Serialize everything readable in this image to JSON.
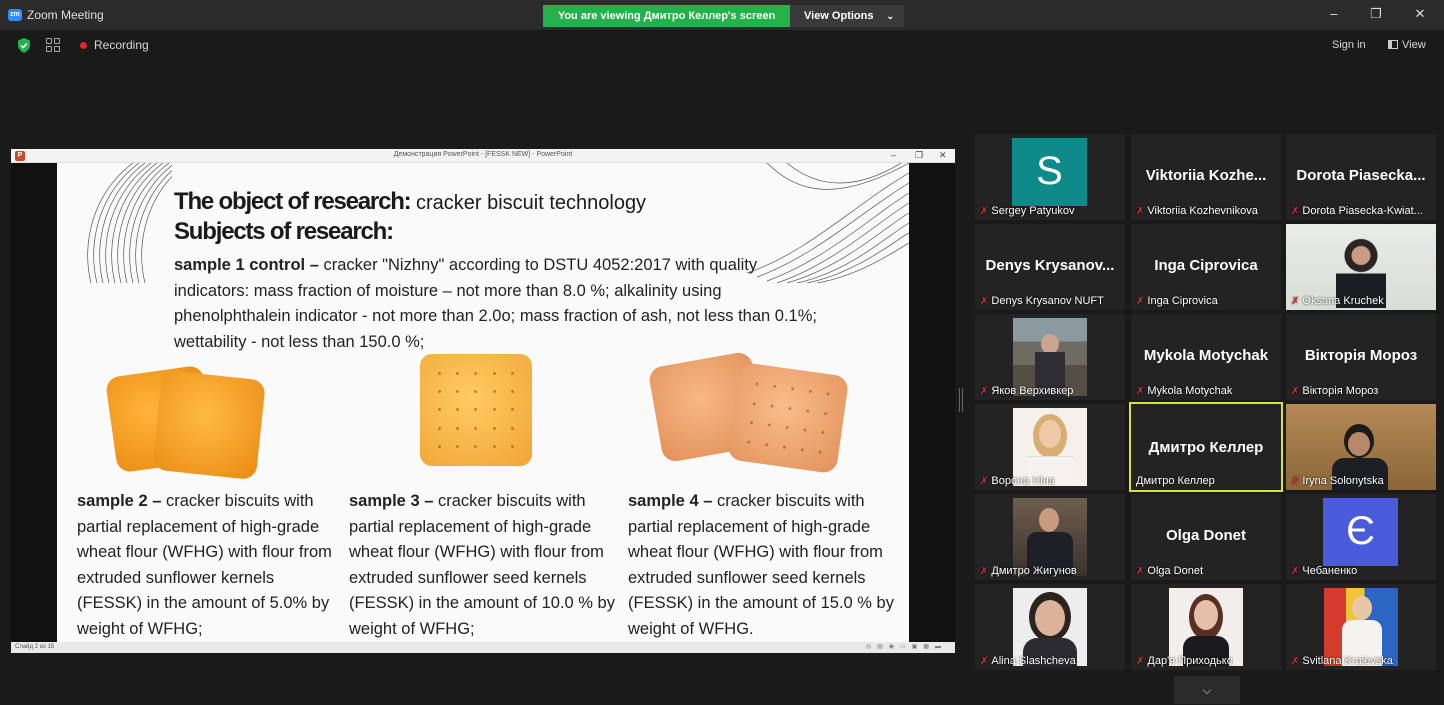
{
  "window": {
    "title": "Zoom Meeting",
    "share_banner": "You are viewing Дмитро Келлер's screen",
    "view_options": "View Options",
    "recording": "Recording",
    "sign_in": "Sign in",
    "view": "View"
  },
  "powerpoint": {
    "title": "Демонстрация PowerPoint - [FESSK NEW] - PowerPoint",
    "status": "Слайд 2 из 15"
  },
  "slide": {
    "title_bold": "The object of research:",
    "title_rest": "cracker biscuit technology",
    "subjects": "Subjects of research:",
    "sample1_bold": "sample 1 control –",
    "sample1_text": "cracker \"Nizhny\" according to DSTU 4052:2017 with quality indicators: mass fraction of moisture – not more than 8.0 %; alkalinity using phenolphthalein indicator - not more than 2.0o; mass fraction of ash, not less than 0.1%; wettability - not less than 150.0 %;",
    "sample2_bold": "sample 2 –",
    "sample2_text": "cracker biscuits with partial replacement of high-grade wheat flour (WFHG) with flour from extruded sunflower kernels (FESSK) in the amount of 5.0% by weight of WFHG;",
    "sample3_bold": "sample 3 –",
    "sample3_text": "cracker biscuits with partial replacement of high-grade wheat flour (WFHG) with flour from extruded sunflower seed kernels (FESSK) in the amount of 10.0 % by weight of WFHG;",
    "sample4_bold": "sample 4 –",
    "sample4_text": "cracker biscuits with partial replacement of high-grade wheat flour (WFHG) with flour from extruded sunflower seed kernels (FESSK) in the amount of 15.0 % by weight of WFHG."
  },
  "participants": [
    {
      "name": "S",
      "label": "Sergey Patyukov",
      "kind": "avatar",
      "color": "#0f8a8a"
    },
    {
      "name": "Viktoriia Kozhe...",
      "label": "Viktoriia Kozhevnikova",
      "kind": "name"
    },
    {
      "name": "Dorota Piasecka...",
      "label": "Dorota Piasecka-Kwiat...",
      "kind": "name"
    },
    {
      "name": "Denys Krysanov...",
      "label": "Denys Krysanov NUFT",
      "kind": "name"
    },
    {
      "name": "Inga Ciprovica",
      "label": "Inga Ciprovica",
      "kind": "name"
    },
    {
      "name": "",
      "label": "Oksana Kruchek",
      "kind": "photo"
    },
    {
      "name": "",
      "label": "Яков Верхивкер",
      "kind": "photo"
    },
    {
      "name": "Mykola Motychak",
      "label": "Mykola Motychak",
      "kind": "name"
    },
    {
      "name": "Вікторія Мороз",
      "label": "Вікторія Мороз",
      "kind": "name"
    },
    {
      "name": "",
      "label": "Ворона Ніна",
      "kind": "photo"
    },
    {
      "name": "Дмитро Келлер",
      "label": "Дмитро Келлер",
      "kind": "name"
    },
    {
      "name": "",
      "label": "Iryna Solonytska",
      "kind": "photo"
    },
    {
      "name": "",
      "label": "Дмитро Жигунов",
      "kind": "photo"
    },
    {
      "name": "Olga Donet",
      "label": "Olga Donet",
      "kind": "name"
    },
    {
      "name": "Є",
      "label": "Чебаненко",
      "kind": "avatar",
      "color": "#4a5bdc"
    },
    {
      "name": "",
      "label": "Alina Slashcheva",
      "kind": "photo"
    },
    {
      "name": "",
      "label": "Дар'я Приходько",
      "kind": "photo"
    },
    {
      "name": "",
      "label": "Svitlana Kraievska",
      "kind": "photo"
    }
  ],
  "colors": {
    "banner": "#24b14a",
    "active_speaker": "#d6e04a",
    "muted_mic": "#e03030"
  }
}
